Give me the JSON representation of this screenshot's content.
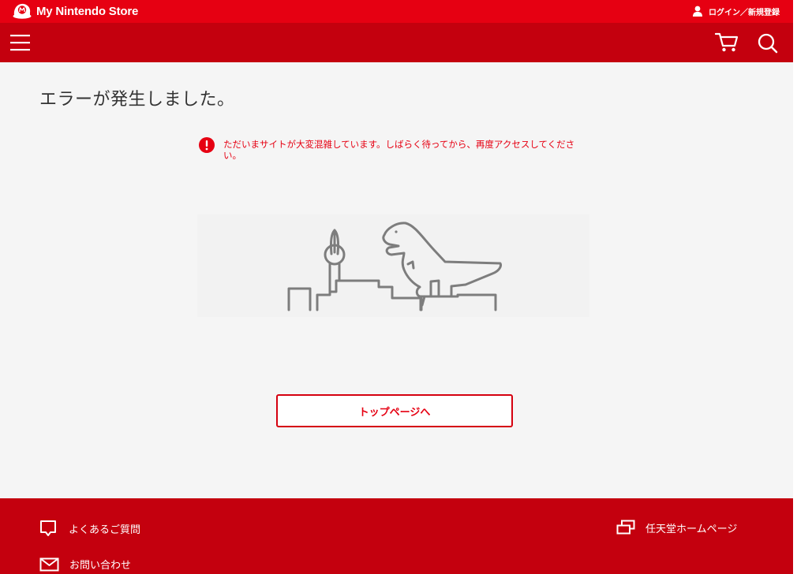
{
  "header": {
    "logo_text": "My Nintendo Store",
    "login_label": "ログイン／新規登録"
  },
  "navbar": {
    "menu_icon": "hamburger-menu-icon",
    "cart_icon": "cart-icon",
    "search_icon": "search-icon"
  },
  "main": {
    "title": "エラーが発生しました。",
    "error_message": "ただいまサイトが大変混雑しています。しばらく待ってから、再度アクセスしてください。",
    "top_button_label": "トップページへ"
  },
  "footer": {
    "faq_label": "よくあるご質問",
    "contact_label": "お問い合わせ",
    "home_label": "任天堂ホームページ"
  },
  "colors": {
    "brand_red": "#e60012",
    "nav_red": "#c4000e",
    "page_bg": "#f5f5f5"
  }
}
